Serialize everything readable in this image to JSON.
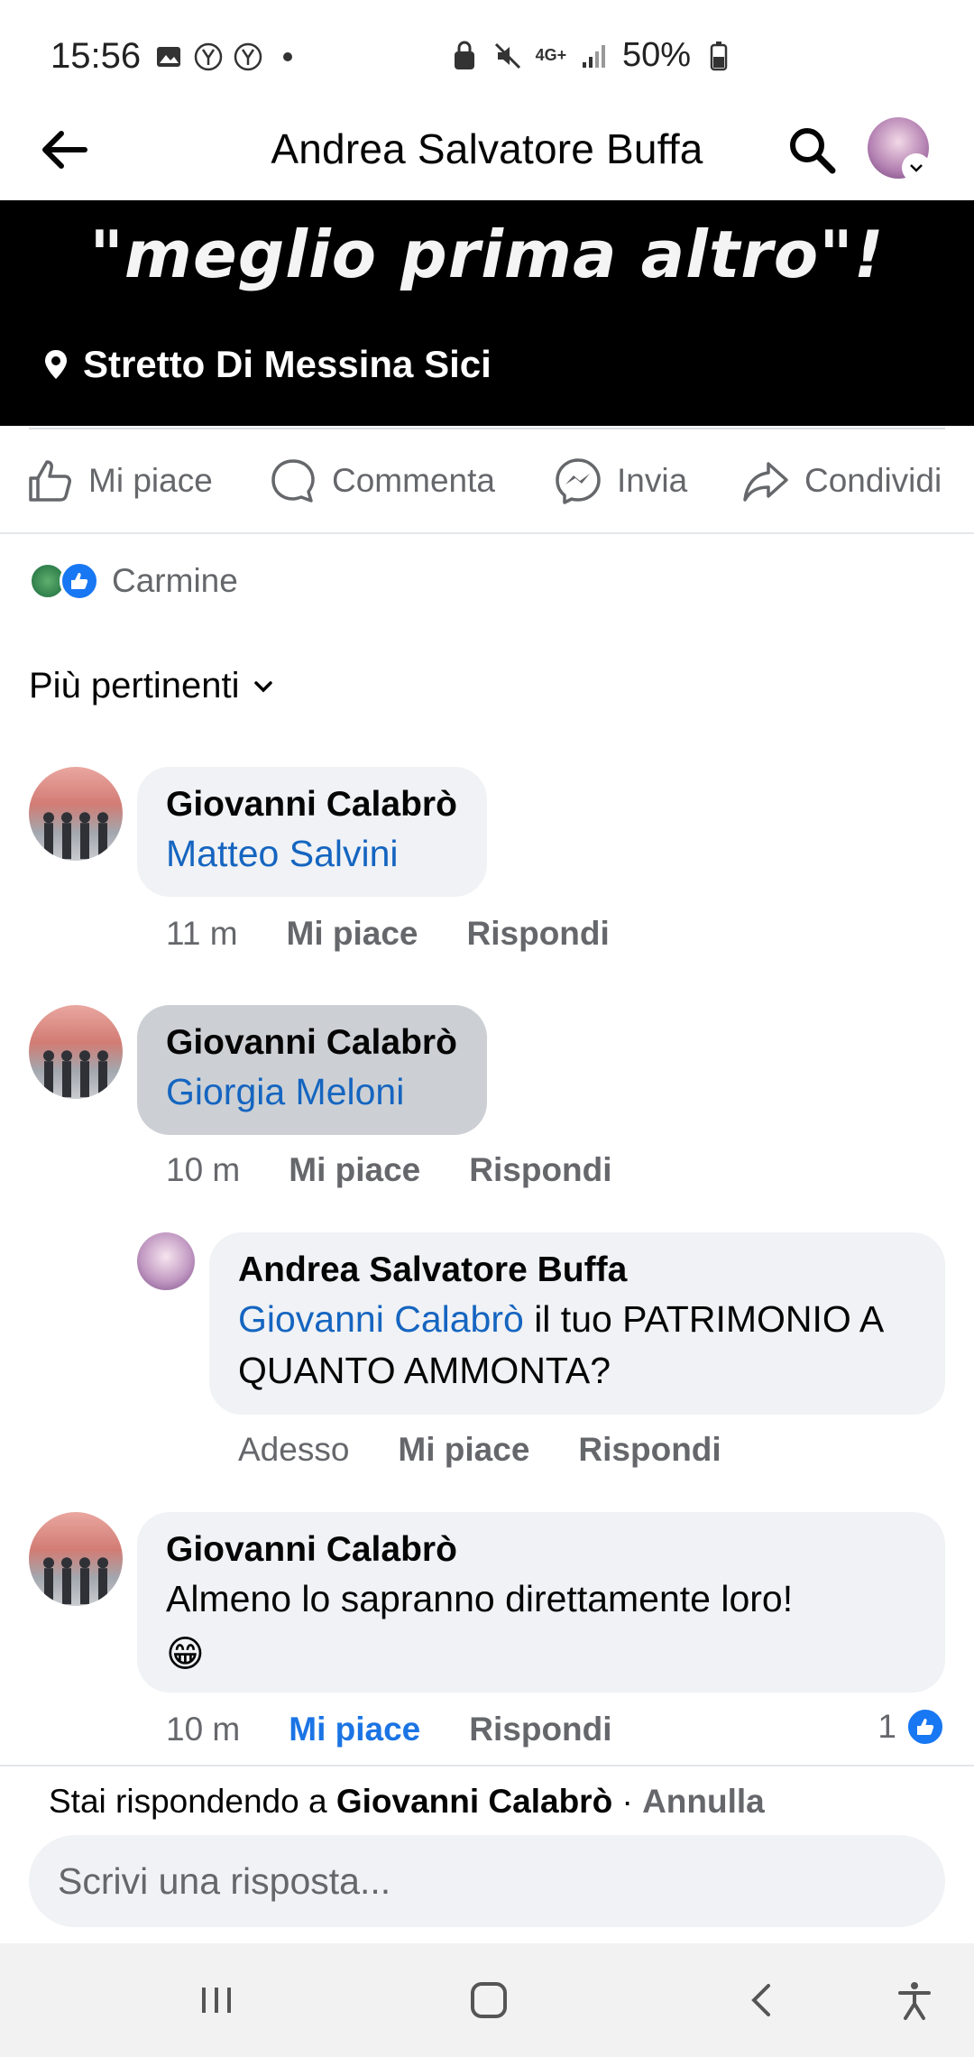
{
  "status_bar": {
    "time": "15:56",
    "battery": "50%",
    "network": "4G+"
  },
  "header": {
    "title": "Andrea Salvatore Buffa",
    "back_icon": "arrow-left-icon",
    "search_icon": "search-icon"
  },
  "banner": {
    "quote": "\"meglio prima altro\"!",
    "location": "Stretto Di Messina Sici"
  },
  "actions": {
    "like": "Mi piace",
    "comment": "Commenta",
    "send": "Invia",
    "share": "Condividi"
  },
  "reactions": {
    "name": "Carmine"
  },
  "sort": {
    "label": "Più pertinenti"
  },
  "comments": [
    {
      "author": "Giovanni Calabrò",
      "mention": "Matteo Salvini",
      "time": "11 m",
      "like_label": "Mi piace",
      "reply_label": "Rispondi"
    },
    {
      "author": "Giovanni Calabrò",
      "mention": "Giorgia Meloni",
      "time": "10 m",
      "like_label": "Mi piace",
      "reply_label": "Rispondi",
      "reply": {
        "author": "Andrea Salvatore Buffa",
        "mention": "Giovanni Calabrò",
        "text": " il tuo PATRIMONIO A QUANTO AMMONTA?",
        "time": "Adesso",
        "like_label": "Mi piace",
        "reply_label": "Rispondi"
      }
    },
    {
      "author": "Giovanni Calabrò",
      "text": "Almeno lo sapranno direttamente loro!",
      "emoji": "😁",
      "time": "10 m",
      "like_label": "Mi piace",
      "reply_label": "Rispondi",
      "like_count": "1"
    }
  ],
  "reply_bar": {
    "prefix": "Stai rispondendo a ",
    "target": "Giovanni Calabrò",
    "separator": " · ",
    "cancel": "Annulla",
    "placeholder": "Scrivi una risposta..."
  },
  "colors": {
    "link": "#1565c0",
    "accent": "#1877f2",
    "bubble": "#f0f2f5",
    "secondary_text": "#65676b"
  }
}
